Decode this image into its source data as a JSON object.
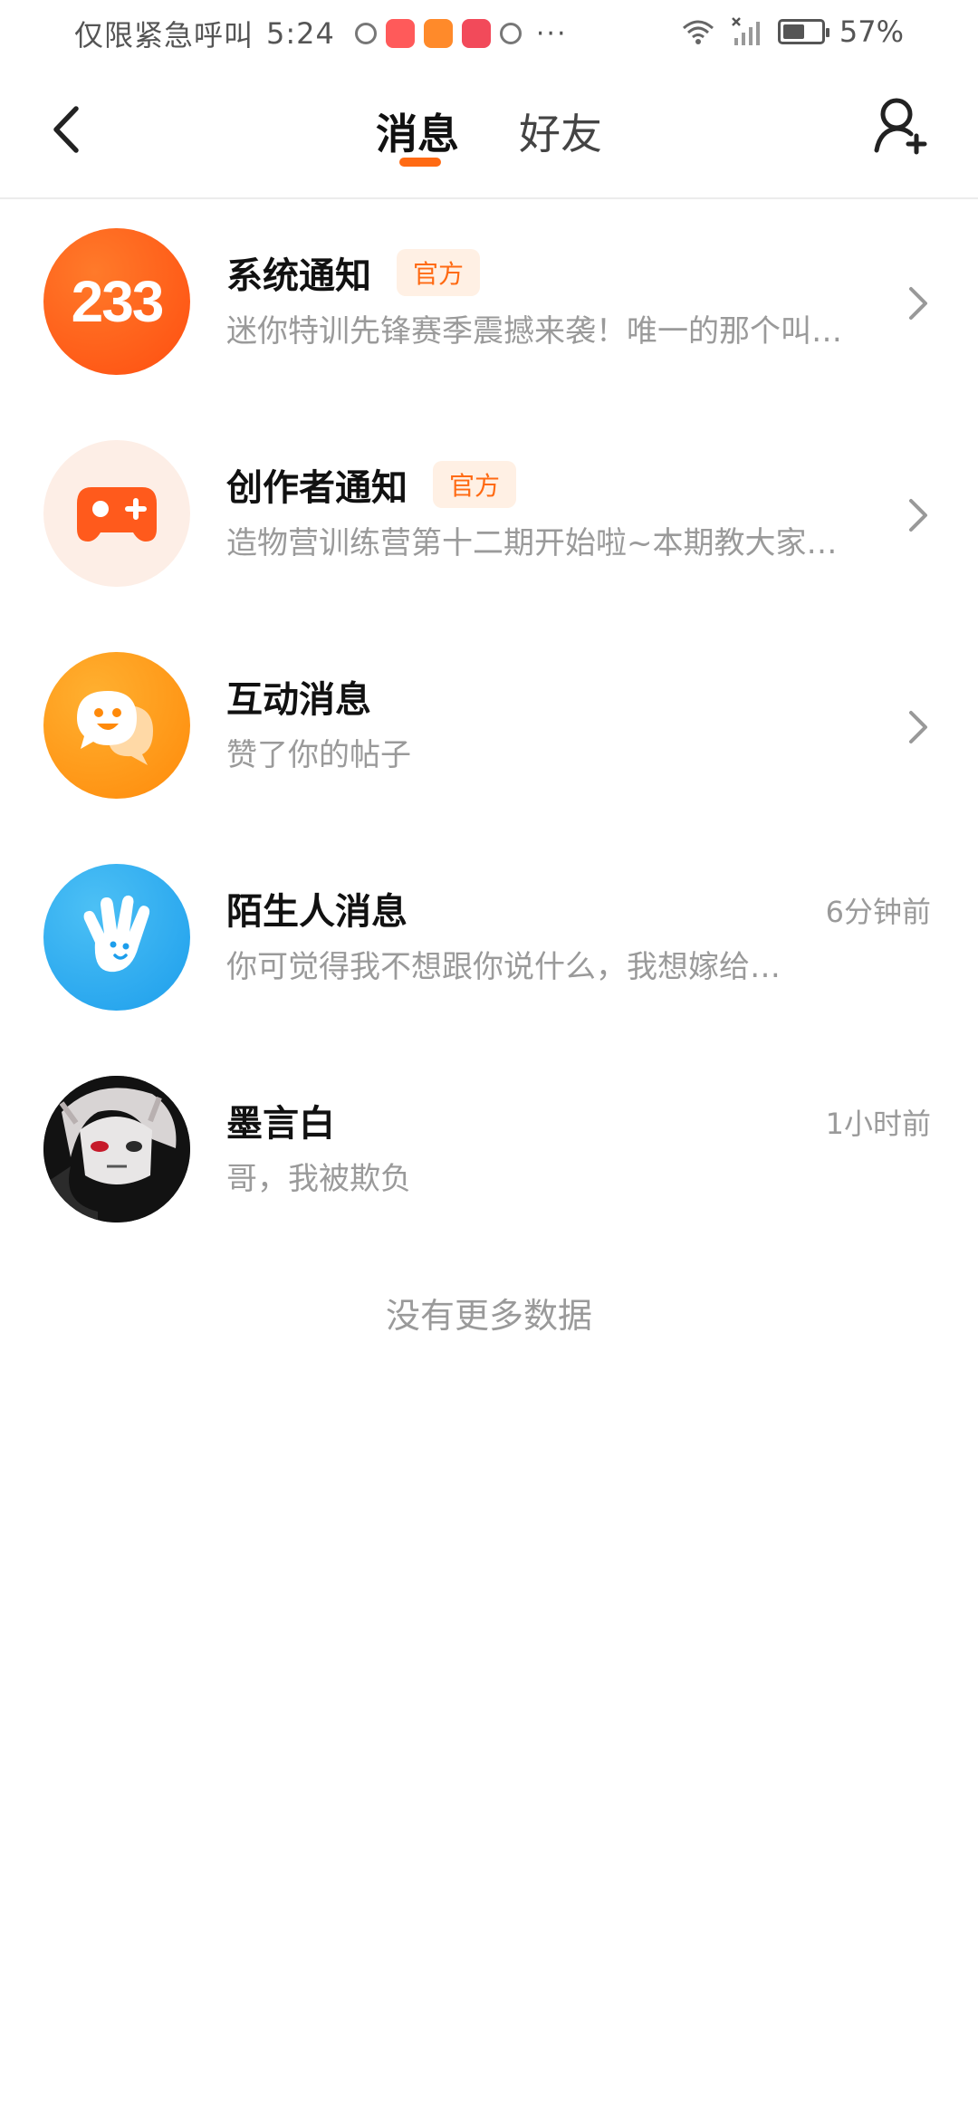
{
  "status_bar": {
    "carrier": "仅限紧急呼叫",
    "time": "5:24",
    "more": "···",
    "battery_percent": "57%",
    "battery_level": 0.57
  },
  "header": {
    "tabs": [
      {
        "label": "消息",
        "active": true
      },
      {
        "label": "好友",
        "active": false
      }
    ]
  },
  "messages": [
    {
      "title": "系统通知",
      "badge": "官方",
      "preview": "迷你特训先锋赛季震撼来袭！唯一的那个叫…",
      "time": "",
      "avatar_text": "233",
      "icon": "logo-233-icon"
    },
    {
      "title": "创作者通知",
      "badge": "官方",
      "preview": "造物营训练营第十二期开始啦~本期教大家…",
      "time": "",
      "icon": "gamepad-icon"
    },
    {
      "title": "互动消息",
      "badge": "",
      "preview": "赞了你的帖子",
      "time": "",
      "icon": "chat-bubble-smile-icon"
    },
    {
      "title": "陌生人消息",
      "badge": "",
      "preview": "你可觉得我不想跟你说什么，我想嫁给…",
      "time": "6分钟前",
      "icon": "waving-hand-icon"
    },
    {
      "title": "墨言白",
      "badge": "",
      "preview": "哥，我被欺负",
      "time": "1小时前",
      "icon": "user-avatar"
    }
  ],
  "footer": {
    "no_more": "没有更多数据"
  },
  "colors": {
    "accent": "#ff6a13",
    "badge_bg": "#fff0e4",
    "system_avatar": "#ff5a1c",
    "creator_avatar_bg": "#fdeee6",
    "interaction_avatar": "#ff9a10",
    "stranger_avatar": "#28aef0"
  }
}
